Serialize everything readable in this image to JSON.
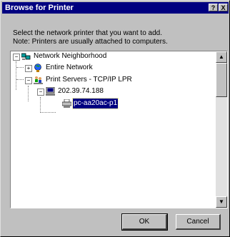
{
  "window": {
    "title": "Browse for Printer",
    "help_glyph": "?",
    "close_glyph": "X"
  },
  "instructions": {
    "line1": "Select the network printer that you want to add.",
    "line2": "Note: Printers are usually attached to computers."
  },
  "tree": {
    "items": [
      {
        "label": "Network Neighborhood",
        "icon": "network-neighborhood-icon",
        "expander": "−"
      },
      {
        "label": "Entire Network",
        "icon": "globe-icon",
        "expander": "+"
      },
      {
        "label": "Print Servers - TCP/IP LPR",
        "icon": "people-network-icon",
        "expander": "−"
      },
      {
        "label": "202.39.74.188",
        "icon": "computer-icon",
        "expander": "−"
      },
      {
        "label": "pc-aa20ac-p1",
        "icon": "printer-icon",
        "selected": true
      }
    ]
  },
  "scrollbar": {
    "up": "▲",
    "down": "▼"
  },
  "buttons": {
    "ok": "OK",
    "cancel": "Cancel"
  },
  "colors": {
    "titlebar": "#000080",
    "selection": "#000080",
    "face": "#c0c0c0"
  }
}
